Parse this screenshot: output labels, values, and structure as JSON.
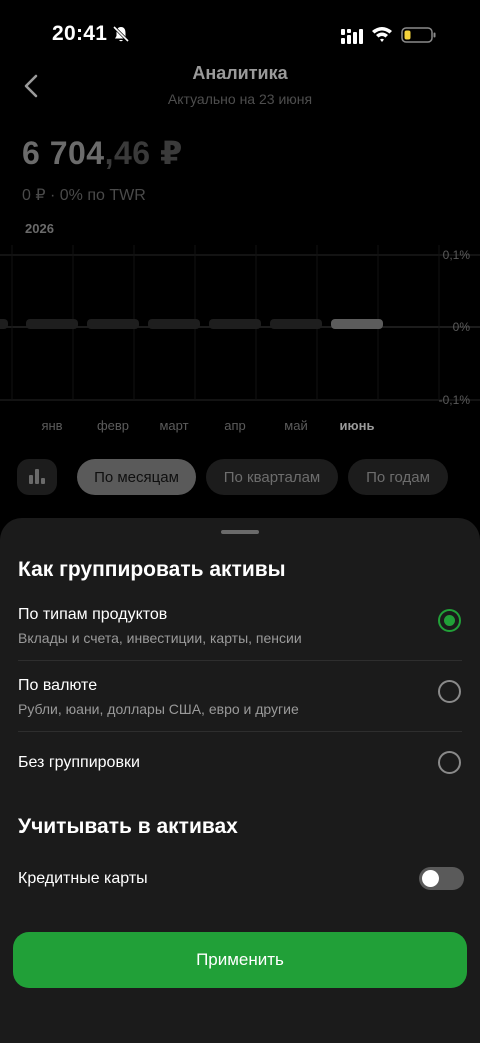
{
  "status_bar": {
    "time": "20:41"
  },
  "header": {
    "title": "Аналитика",
    "subtitle": "Актуально на 23 июня"
  },
  "summary": {
    "amount_int": "6 704",
    "amount_dec": ",46 ₽",
    "change": "0 ₽ · 0%  по TWR"
  },
  "chart_data": {
    "type": "bar",
    "year_label": "2026",
    "categories": [
      "янв",
      "февр",
      "март",
      "апр",
      "май",
      "июнь"
    ],
    "values": [
      0,
      0,
      0,
      0,
      0,
      0
    ],
    "y_ticks": [
      "0,1%",
      "0%",
      "-0,1%"
    ],
    "ylim": [
      -0.1,
      0.1
    ],
    "selected_category": "июнь",
    "colors": {
      "bar": "#1e1e1e",
      "bar_selected": "#5c5c5c",
      "grid": "#262626"
    }
  },
  "periods": {
    "items": [
      {
        "label": "По месяцам",
        "active": true
      },
      {
        "label": "По кварталам",
        "active": false
      },
      {
        "label": "По годам",
        "active": false
      }
    ]
  },
  "sheet": {
    "group_title": "Как группировать активы",
    "options": [
      {
        "title": "По типам продуктов",
        "desc": "Вклады и счета, инвестиции, карты, пенсии",
        "selected": true
      },
      {
        "title": "По валюте",
        "desc": "Рубли, юани, доллары США, евро и другие",
        "selected": false
      },
      {
        "title": "Без группировки",
        "desc": "",
        "selected": false
      }
    ],
    "include_title": "Учитывать в активах",
    "credit_cards_label": "Кредитные карты",
    "credit_cards_on": false,
    "apply_label": "Применить"
  },
  "colors": {
    "accent": "#21a038",
    "sheet_bg": "#1b1b1b"
  }
}
